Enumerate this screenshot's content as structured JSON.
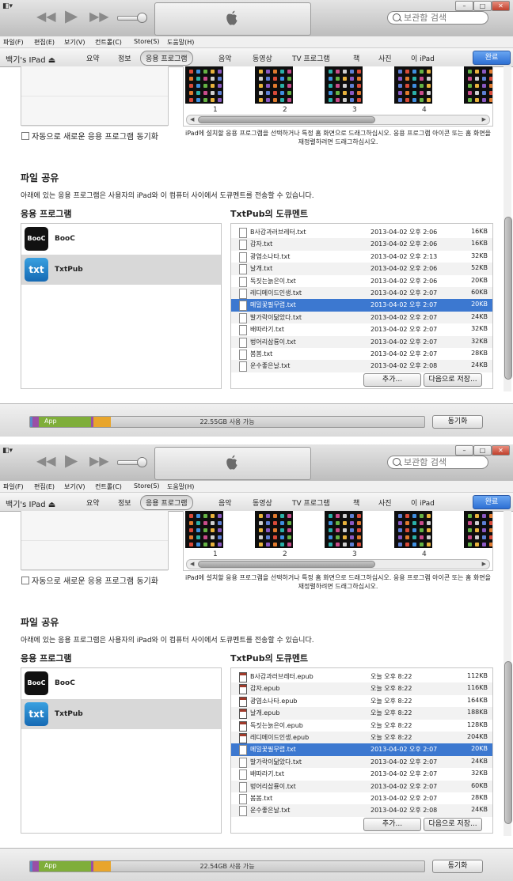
{
  "panels": [
    {
      "id": "panel-1",
      "search_placeholder": "보관함 검색",
      "menubar": [
        "파일(F)",
        "편집(E)",
        "보기(V)",
        "컨트롤(C)",
        "Store(S)",
        "도움말(H)"
      ],
      "device_name": "백기's IPad ⏏",
      "nav_tabs": [
        "요약",
        "정보",
        "응용 프로그램",
        "음악",
        "동영상",
        "TV 프로그램",
        "책",
        "사진",
        "이 iPad"
      ],
      "active_tab": 2,
      "done_label": "완료",
      "auto_sync_label": "자동으로 새로운 응용 프로그램 동기화",
      "page_numbers": [
        "1",
        "2",
        "3",
        "4"
      ],
      "drag_hint": "iPad에 설치할 응용 프로그램을 선택하거나 특정 홈 화면으로 드래그하십시오. 응용 프로그램 아이콘 또는 홈 화면을 재정렬하려면 드래그하십시오.",
      "file_sharing_title": "파일 공유",
      "file_sharing_desc": "아래에 있는 응용 프로그램은 사용자의 iPad와 이 컴퓨터 사이에서 도큐멘트를 전송할 수 있습니다.",
      "apps_heading": "응용 프로그램",
      "docs_heading": "TxtPub의 도큐멘트",
      "apps": [
        {
          "name": "BooC",
          "icon": "booc-app-icon",
          "icon_text": "BooC",
          "selected": false
        },
        {
          "name": "TxtPub",
          "icon": "txtpub-app-icon",
          "icon_text": "txt",
          "selected": true
        }
      ],
      "documents": [
        {
          "name": "B사감과러브레터.txt",
          "date": "2013-04-02 오후 2:06",
          "size": "16KB",
          "type": "txt"
        },
        {
          "name": "감자.txt",
          "date": "2013-04-02 오후 2:06",
          "size": "16KB",
          "type": "txt"
        },
        {
          "name": "광염소나타.txt",
          "date": "2013-04-02 오후 2:13",
          "size": "32KB",
          "type": "txt"
        },
        {
          "name": "날개.txt",
          "date": "2013-04-02 오후 2:06",
          "size": "52KB",
          "type": "txt"
        },
        {
          "name": "독짓는늙은이.txt",
          "date": "2013-04-02 오후 2:06",
          "size": "20KB",
          "type": "txt"
        },
        {
          "name": "레디메이드인생.txt",
          "date": "2013-04-02 오후 2:07",
          "size": "60KB",
          "type": "txt"
        },
        {
          "name": "메밀꽃필무렵.txt",
          "date": "2013-04-02 오후 2:07",
          "size": "20KB",
          "type": "txt"
        },
        {
          "name": "발가락이닮았다.txt",
          "date": "2013-04-02 오후 2:07",
          "size": "24KB",
          "type": "txt"
        },
        {
          "name": "배따라기.txt",
          "date": "2013-04-02 오후 2:07",
          "size": "32KB",
          "type": "txt"
        },
        {
          "name": "벙어리삼룡이.txt",
          "date": "2013-04-02 오후 2:07",
          "size": "32KB",
          "type": "txt"
        },
        {
          "name": "봄봄.txt",
          "date": "2013-04-02 오후 2:07",
          "size": "28KB",
          "type": "txt"
        },
        {
          "name": "운수좋은날.txt",
          "date": "2013-04-02 오후 2:08",
          "size": "24KB",
          "type": "txt"
        }
      ],
      "selected_doc": 6,
      "add_label": "추가...",
      "save_as_label": "다음으로 저장...",
      "capacity_app_label": "App",
      "capacity_free": "22.55GB 사용 가능",
      "sync_label": "동기화"
    },
    {
      "id": "panel-2",
      "search_placeholder": "보관함 검색",
      "menubar": [
        "파일(F)",
        "편집(E)",
        "보기(V)",
        "컨트롤(C)",
        "Store(S)",
        "도움말(H)"
      ],
      "device_name": "백기's IPad ⏏",
      "nav_tabs": [
        "요약",
        "정보",
        "응용 프로그램",
        "음악",
        "동영상",
        "TV 프로그램",
        "책",
        "사진",
        "이 iPad"
      ],
      "active_tab": 2,
      "done_label": "완료",
      "auto_sync_label": "자동으로 새로운 응용 프로그램 동기화",
      "page_numbers": [
        "1",
        "2",
        "3",
        "4"
      ],
      "drag_hint": "iPad에 설치할 응용 프로그램을 선택하거나 특정 홈 화면으로 드래그하십시오. 응용 프로그램 아이콘 또는 홈 화면을 재정렬하려면 드래그하십시오.",
      "file_sharing_title": "파일 공유",
      "file_sharing_desc": "아래에 있는 응용 프로그램은 사용자의 iPad와 이 컴퓨터 사이에서 도큐멘트를 전송할 수 있습니다.",
      "apps_heading": "응용 프로그램",
      "docs_heading": "TxtPub의 도큐멘트",
      "apps": [
        {
          "name": "BooC",
          "icon": "booc-app-icon",
          "icon_text": "BooC",
          "selected": false
        },
        {
          "name": "TxtPub",
          "icon": "txtpub-app-icon",
          "icon_text": "txt",
          "selected": true
        }
      ],
      "documents": [
        {
          "name": "B사감과러브레터.epub",
          "date": "오늘 오후 8:22",
          "size": "112KB",
          "type": "epub"
        },
        {
          "name": "감자.epub",
          "date": "오늘 오후 8:22",
          "size": "116KB",
          "type": "epub"
        },
        {
          "name": "광염소나타.epub",
          "date": "오늘 오후 8:22",
          "size": "164KB",
          "type": "epub"
        },
        {
          "name": "날개.epub",
          "date": "오늘 오후 8:22",
          "size": "188KB",
          "type": "epub"
        },
        {
          "name": "독짓는늙은이.epub",
          "date": "오늘 오후 8:22",
          "size": "128KB",
          "type": "epub"
        },
        {
          "name": "레디메이드인생.epub",
          "date": "오늘 오후 8:22",
          "size": "204KB",
          "type": "epub"
        },
        {
          "name": "메밀꽃필무렵.txt",
          "date": "2013-04-02 오후 2:07",
          "size": "20KB",
          "type": "txt"
        },
        {
          "name": "발가락이닮았다.txt",
          "date": "2013-04-02 오후 2:07",
          "size": "24KB",
          "type": "txt"
        },
        {
          "name": "배따라기.txt",
          "date": "2013-04-02 오후 2:07",
          "size": "32KB",
          "type": "txt"
        },
        {
          "name": "벙어리삼룡이.txt",
          "date": "2013-04-02 오후 2:07",
          "size": "60KB",
          "type": "txt"
        },
        {
          "name": "봄봄.txt",
          "date": "2013-04-02 오후 2:07",
          "size": "28KB",
          "type": "txt"
        },
        {
          "name": "운수좋은날.txt",
          "date": "2013-04-02 오후 2:08",
          "size": "24KB",
          "type": "txt"
        }
      ],
      "selected_doc": 6,
      "add_label": "추가...",
      "save_as_label": "다음으로 저장...",
      "capacity_app_label": "App",
      "capacity_free": "22.54GB 사용 가능",
      "sync_label": "동기화"
    }
  ],
  "colors": {
    "selection_blue": "#3c78d0",
    "done_button_blue": "#2d6fd3",
    "capacity_app_green": "#7fae3a",
    "capacity_other_orange": "#e8a52c",
    "capacity_audio_purple": "#9a4fa6"
  }
}
